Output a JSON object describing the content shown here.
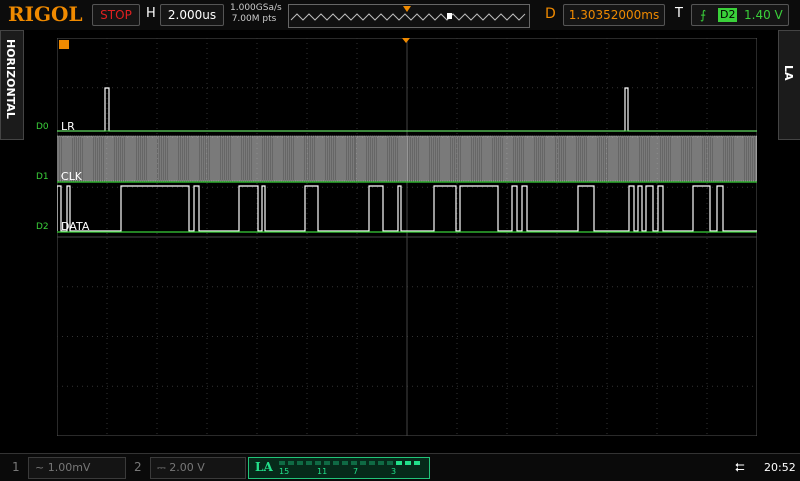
{
  "header": {
    "logo": "RIGOL",
    "run_state": "STOP",
    "h_label": "H",
    "timebase": "2.000us",
    "sample_rate": "1.000GSa/s",
    "mem_depth": "7.00M pts",
    "d_label": "D",
    "delay": "1.30352000ms",
    "t_label": "T",
    "trigger_source": "D2",
    "trigger_level": "1.40 V"
  },
  "left_tab": "HORIZONTAL",
  "right_tab": "LA",
  "channels": [
    {
      "id": "D0",
      "label": "LR"
    },
    {
      "id": "D1",
      "label": "CLK"
    },
    {
      "id": "D2",
      "label": "DATA"
    }
  ],
  "bottom": {
    "ch1_num": "1",
    "ch1_val": "1.00mV",
    "ch2_num": "2",
    "ch2_val": "2.00 V",
    "la_label": "LA",
    "la_numbers": [
      "15",
      "11",
      "7",
      "3"
    ],
    "clock": "20:52"
  },
  "colors": {
    "accent": "#f08a00",
    "stop": "#e02020",
    "trace": "#3ad13a",
    "la": "#22e08a"
  }
}
